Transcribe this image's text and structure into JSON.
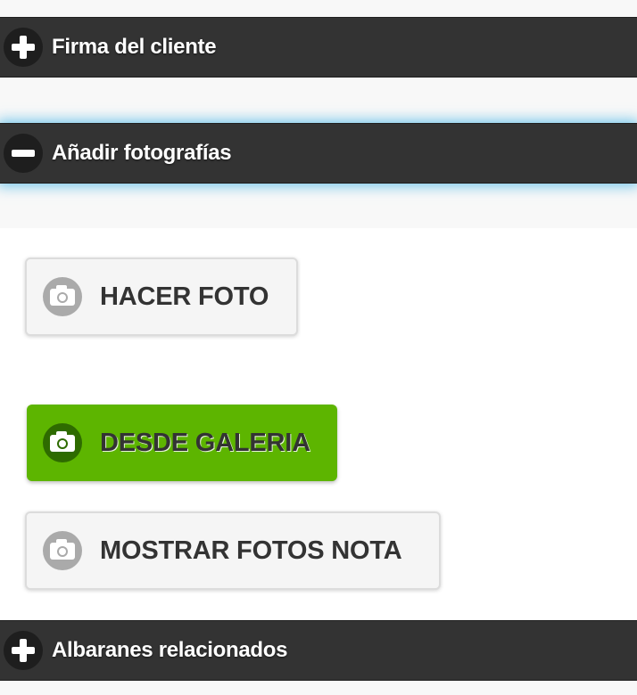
{
  "sections": {
    "signature": {
      "label": "Firma del cliente",
      "state": "collapsed",
      "icon": "plus-icon"
    },
    "photos": {
      "label": "Añadir fotografías",
      "state": "expanded",
      "icon": "minus-icon"
    },
    "delivery_notes": {
      "label": "Albaranes relacionados",
      "state": "collapsed",
      "icon": "plus-icon"
    }
  },
  "photo_actions": {
    "take_photo": {
      "label": "HACER FOTO",
      "icon": "camera-icon"
    },
    "from_gallery": {
      "label": "DESDE GALERIA",
      "icon": "camera-icon"
    },
    "show_note_photos": {
      "label": "MOSTRAR FOTOS NOTA",
      "icon": "camera-icon"
    }
  },
  "colors": {
    "section_bar": "#333333",
    "active_glow": "#46b4e6",
    "primary_button": "#5db500",
    "default_button": "#f5f5f5"
  }
}
